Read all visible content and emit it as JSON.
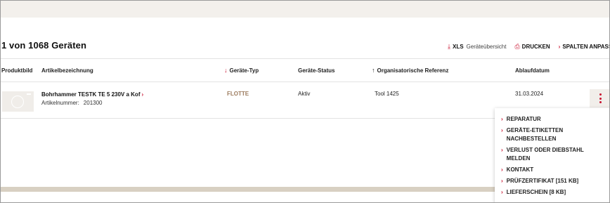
{
  "results": {
    "title": "1 von 1068 Geräten"
  },
  "toolbar": {
    "xls_label": "XLS",
    "xls_sub": "Geräteübersicht",
    "print_label": "DRUCKEN",
    "columns_label": "SPALTEN ANPASSEN"
  },
  "table": {
    "headers": {
      "image": "Produktbild",
      "name": "Artikelbezeichnung",
      "type": "Geräte-Typ",
      "status": "Geräte-Status",
      "ref": "Organisatorische Referenz",
      "expiry": "Ablaufdatum"
    },
    "rows": [
      {
        "name": "Bohrhammer TESTK TE 5 230V a Kof",
        "number_label": "Artikelnummer:",
        "number": "201300",
        "type": "FLOTTE",
        "status": "Aktiv",
        "ref": "Tool 1425",
        "expiry": "31.03.2024"
      }
    ]
  },
  "context_menu": {
    "items": [
      {
        "label": "REPARATUR"
      },
      {
        "label": "GERÄTE-ETIKETTEN NACHBESTELLEN"
      },
      {
        "label": "VERLUST ODER DIEBSTAHL MELDEN"
      },
      {
        "label": "KONTAKT"
      },
      {
        "label": "PRÜFZERTIFIKAT [151 KB]"
      },
      {
        "label": "LIEFERSCHEIN [8 KB]"
      }
    ]
  },
  "icons": {
    "download": "download-icon",
    "print": "printer-icon",
    "chevron": "chevron-right-icon",
    "sort_down": "sort-down-arrow-icon",
    "sort_up": "sort-up-arrow-icon",
    "more": "kebab-menu-icon"
  },
  "colors": {
    "accent": "#c8102e",
    "fleet_type": "#9c7b5e",
    "top_band": "#f3f0ec",
    "footer_band": "#d8d0c2"
  }
}
